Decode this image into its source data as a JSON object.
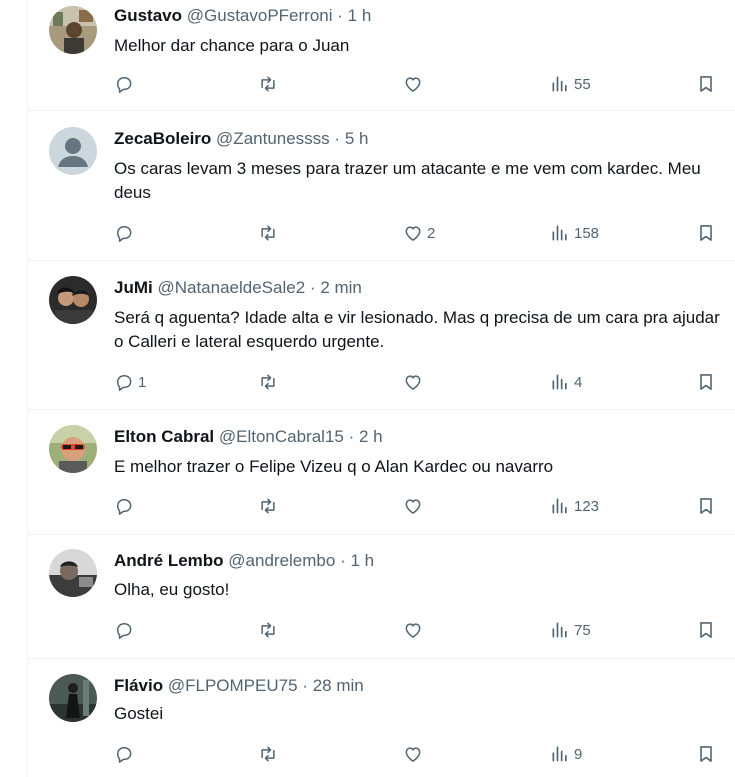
{
  "replies": [
    {
      "name": "Gustavo",
      "handle": "@GustavoPFerroni",
      "dot": "·",
      "time": "1 h",
      "text": "Melhor dar chance para o Juan",
      "reply_count": "",
      "repost_count": "",
      "like_count": "",
      "views": "55",
      "avatar_icon": "user-photo-icon"
    },
    {
      "name": "ZecaBoleiro",
      "handle": "@Zantunessss",
      "dot": "·",
      "time": "5 h",
      "text": "Os caras levam 3 meses para trazer um atacante e me vem com kardec. Meu deus",
      "reply_count": "",
      "repost_count": "",
      "like_count": "2",
      "views": "158",
      "avatar_icon": "default-avatar-icon"
    },
    {
      "name": "JuMi",
      "handle": "@NatanaeldeSale2",
      "dot": "·",
      "time": "2 min",
      "text": "Será q aguenta? Idade alta e vir lesionado. Mas q precisa de um cara pra ajudar o Calleri e lateral esquerdo urgente.",
      "reply_count": "1",
      "repost_count": "",
      "like_count": "",
      "views": "4",
      "avatar_icon": "user-photo-icon"
    },
    {
      "name": "Elton Cabral",
      "handle": "@EltonCabral15",
      "dot": "·",
      "time": "2 h",
      "text": "E melhor trazer o Felipe Vizeu q o Alan Kardec ou navarro",
      "reply_count": "",
      "repost_count": "",
      "like_count": "",
      "views": "123",
      "avatar_icon": "user-photo-icon"
    },
    {
      "name": "André Lembo",
      "handle": "@andrelembo",
      "dot": "·",
      "time": "1 h",
      "text": "Olha, eu gosto!",
      "reply_count": "",
      "repost_count": "",
      "like_count": "",
      "views": "75",
      "avatar_icon": "user-photo-icon"
    },
    {
      "name": "Flávio",
      "handle": "@FLPOMPEU75",
      "dot": "·",
      "time": "28 min",
      "text": "Gostei",
      "reply_count": "",
      "repost_count": "",
      "like_count": "",
      "views": "9",
      "avatar_icon": "user-photo-icon"
    }
  ],
  "colors": {
    "text_primary": "#0f1419",
    "text_secondary": "#536471",
    "divider": "#eff3f4"
  }
}
